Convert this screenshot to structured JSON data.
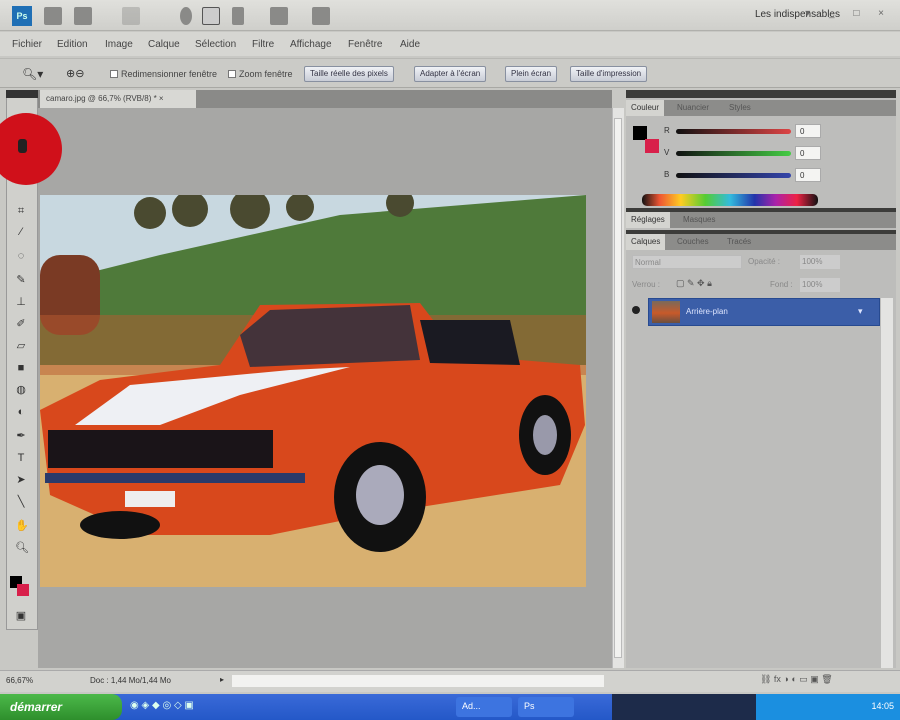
{
  "app": {
    "logo": "Ps",
    "workspace": "Les indispensables"
  },
  "menu": [
    "Fichier",
    "Edition",
    "Image",
    "Calque",
    "Sélection",
    "Filtre",
    "Affichage",
    "Fenêtre",
    "Aide"
  ],
  "options": {
    "checkboxes": [
      "Redimensionner fenêtre",
      "Zoom fenêtre"
    ],
    "buttons": [
      "Taille réelle des pixels",
      "Adapter à l'écran",
      "Plein écran",
      "Taille d'impression"
    ]
  },
  "document": {
    "tab": "camaro.jpg @ 66,7% (RVB/8) *",
    "zoom": "66,67%",
    "doc_info": "Doc : 1,44 Mo/1,44 Mo"
  },
  "panels": {
    "color_tabs": [
      "Couleur",
      "Nuancier",
      "Styles"
    ],
    "color": {
      "channels": [
        {
          "label": "R",
          "value": "0"
        },
        {
          "label": "V",
          "value": "0"
        },
        {
          "label": "B",
          "value": "0"
        }
      ],
      "fg": "#000000",
      "bg": "#d8204a"
    },
    "adjust_tabs": [
      "Réglages",
      "Masques"
    ],
    "layer_tabs": [
      "Calques",
      "Couches",
      "Tracés"
    ],
    "layers": {
      "blend": "Normal",
      "opacity_label": "Opacité :",
      "opacity": "100%",
      "lock_label": "Verrou :",
      "fill_label": "Fond :",
      "fill": "100%",
      "items": [
        {
          "name": "Arrière-plan"
        }
      ]
    }
  },
  "taskbar": {
    "start": "démarrer",
    "tasks": [
      "Ad...",
      "Ps"
    ],
    "clock": "14:05"
  }
}
